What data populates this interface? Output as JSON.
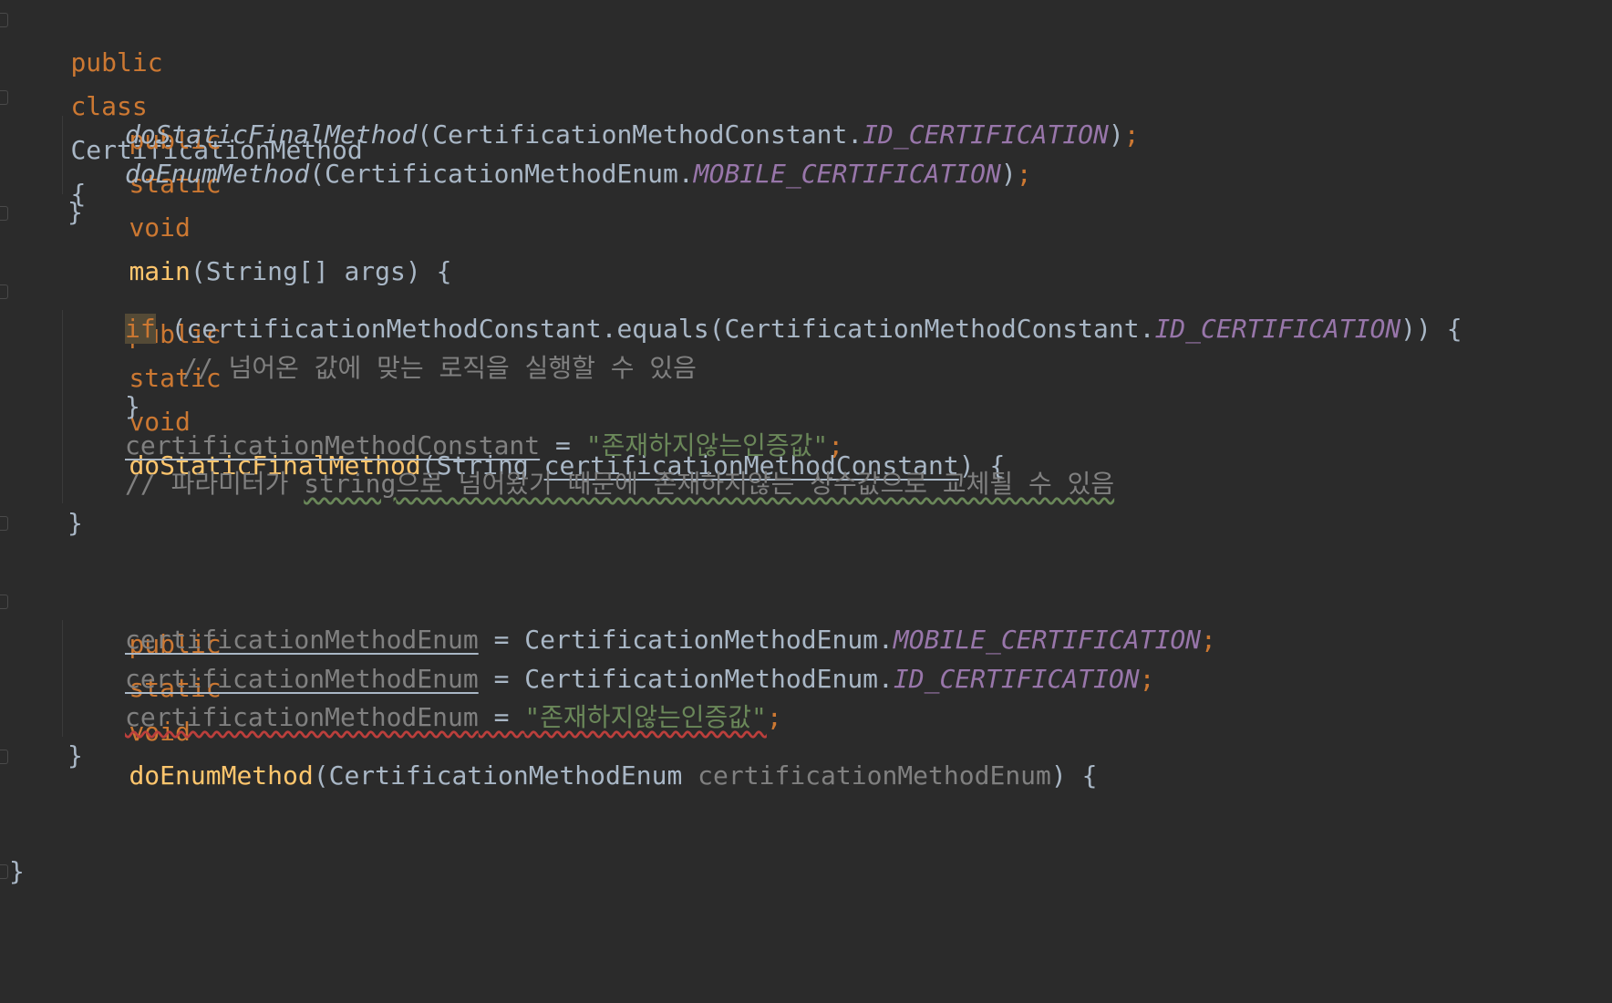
{
  "code": {
    "l1": {
      "kw1": "public",
      "kw2": "class",
      "name": "CertificationMethod",
      "brace": "{"
    },
    "l2": {
      "kw1": "public",
      "kw2": "static",
      "kw3": "void",
      "fn": "main",
      "args": "(String[] args) {"
    },
    "l3": {
      "call": "doStaticFinalMethod",
      "open": "(CertificationMethodConstant.",
      "const": "ID_CERTIFICATION",
      "close": ")",
      "semi": ";"
    },
    "l4": {
      "call": "doEnumMethod",
      "open": "(CertificationMethodEnum.",
      "const": "MOBILE_CERTIFICATION",
      "close": ")",
      "semi": ";"
    },
    "l5": {
      "brace": "}"
    },
    "l6": {
      "kw1": "public",
      "kw2": "static",
      "kw3": "void",
      "fn": "doStaticFinalMethod",
      "open": "(String ",
      "param": "certificationMethodConstant",
      "close": ") {"
    },
    "l7": {
      "kw": "if",
      "mid": " (certificationMethodConstant.equals(CertificationMethodConstant.",
      "const": "ID_CERTIFICATION",
      "close": ")) {"
    },
    "l8": {
      "comment": "// 넘어온 값에 맞는 로직을 실행할 수 있음"
    },
    "l9": {
      "brace": "}"
    },
    "l10": {
      "var": "certificationMethodConstant",
      "eq": " = ",
      "str": "\"존재하지않는인증값\"",
      "semi": ";"
    },
    "l11": {
      "c1": "// 파라미터가 ",
      "c2": "string",
      "c3": "으로 넘어왔기 때문에 존재하지않는 상수값으로 교체될 수 있음"
    },
    "l12": {
      "brace": "}"
    },
    "l13": {
      "kw1": "public",
      "kw2": "static",
      "kw3": "void",
      "fn": "doEnumMethod",
      "open": "(CertificationMethodEnum ",
      "param": "certificationMethodEnum",
      "close": ") {"
    },
    "l14": {
      "var": "certificationMethodEnum",
      "eq": " = CertificationMethodEnum.",
      "const": "MOBILE_CERTIFICATION",
      "semi": ";"
    },
    "l15": {
      "var": "certificationMethodEnum",
      "eq": " = CertificationMethodEnum.",
      "const": "ID_CERTIFICATION",
      "semi": ";"
    },
    "l16": {
      "var": "certificationMethodEnum",
      "eq": " = ",
      "str": "\"존재하지않는인증값\"",
      "semi": ";"
    },
    "l17": {
      "brace": "}"
    },
    "l18": {
      "brace": "}"
    }
  }
}
